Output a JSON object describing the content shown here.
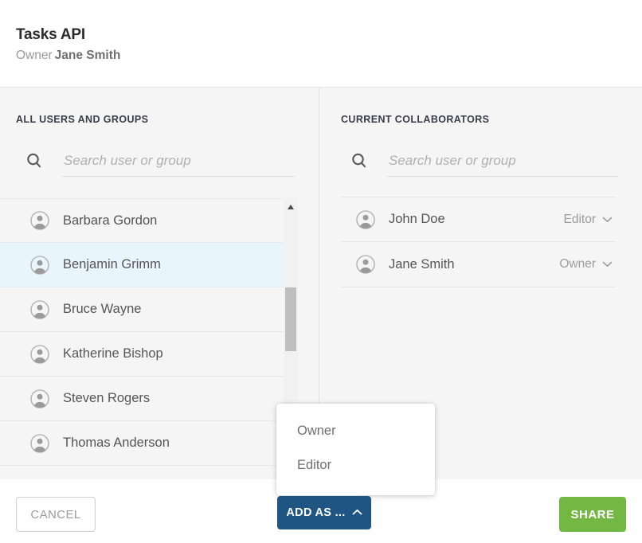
{
  "header": {
    "title": "Tasks API",
    "owner_label": "Owner",
    "owner_name": "Jane Smith"
  },
  "left_panel": {
    "section_title": "ALL USERS AND GROUPS",
    "search": {
      "placeholder": "Search user or group",
      "value": "",
      "icon": "search-icon"
    },
    "users": [
      {
        "name": "Barbara Gordon",
        "selected": false
      },
      {
        "name": "Benjamin Grimm",
        "selected": true
      },
      {
        "name": "Bruce Wayne",
        "selected": false
      },
      {
        "name": "Katherine Bishop",
        "selected": false
      },
      {
        "name": "Steven Rogers",
        "selected": false
      },
      {
        "name": "Thomas Anderson",
        "selected": false
      }
    ],
    "scrollbar": {
      "up_arrow_icon": "triangle-up-icon",
      "thumb_color": "#bfbfbf"
    }
  },
  "right_panel": {
    "section_title": "CURRENT COLLABORATORS",
    "search": {
      "placeholder": "Search user or group",
      "value": "",
      "icon": "search-icon"
    },
    "collaborators": [
      {
        "name": "John Doe",
        "role": "Editor"
      },
      {
        "name": "Jane Smith",
        "role": "Owner"
      }
    ]
  },
  "role_menu": {
    "open": true,
    "options": [
      "Owner",
      "Editor"
    ]
  },
  "footer": {
    "cancel_label": "CANCEL",
    "add_as_label": "ADD AS ...",
    "share_label": "SHARE"
  },
  "colors": {
    "accent_blue": "#1f5582",
    "share_green": "#74b844",
    "selected_row": "#e8f5fd",
    "body_bg": "#f5f5f6",
    "muted_text": "#9b9b9b"
  }
}
